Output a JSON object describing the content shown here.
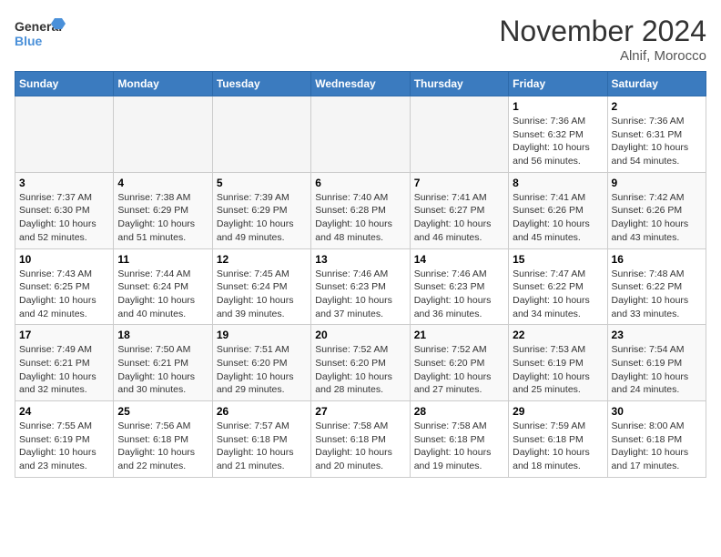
{
  "logo": {
    "line1": "General",
    "line2": "Blue"
  },
  "title": "November 2024",
  "location": "Alnif, Morocco",
  "days_header": [
    "Sunday",
    "Monday",
    "Tuesday",
    "Wednesday",
    "Thursday",
    "Friday",
    "Saturday"
  ],
  "weeks": [
    [
      {
        "num": "",
        "info": ""
      },
      {
        "num": "",
        "info": ""
      },
      {
        "num": "",
        "info": ""
      },
      {
        "num": "",
        "info": ""
      },
      {
        "num": "",
        "info": ""
      },
      {
        "num": "1",
        "info": "Sunrise: 7:36 AM\nSunset: 6:32 PM\nDaylight: 10 hours and 56 minutes."
      },
      {
        "num": "2",
        "info": "Sunrise: 7:36 AM\nSunset: 6:31 PM\nDaylight: 10 hours and 54 minutes."
      }
    ],
    [
      {
        "num": "3",
        "info": "Sunrise: 7:37 AM\nSunset: 6:30 PM\nDaylight: 10 hours and 52 minutes."
      },
      {
        "num": "4",
        "info": "Sunrise: 7:38 AM\nSunset: 6:29 PM\nDaylight: 10 hours and 51 minutes."
      },
      {
        "num": "5",
        "info": "Sunrise: 7:39 AM\nSunset: 6:29 PM\nDaylight: 10 hours and 49 minutes."
      },
      {
        "num": "6",
        "info": "Sunrise: 7:40 AM\nSunset: 6:28 PM\nDaylight: 10 hours and 48 minutes."
      },
      {
        "num": "7",
        "info": "Sunrise: 7:41 AM\nSunset: 6:27 PM\nDaylight: 10 hours and 46 minutes."
      },
      {
        "num": "8",
        "info": "Sunrise: 7:41 AM\nSunset: 6:26 PM\nDaylight: 10 hours and 45 minutes."
      },
      {
        "num": "9",
        "info": "Sunrise: 7:42 AM\nSunset: 6:26 PM\nDaylight: 10 hours and 43 minutes."
      }
    ],
    [
      {
        "num": "10",
        "info": "Sunrise: 7:43 AM\nSunset: 6:25 PM\nDaylight: 10 hours and 42 minutes."
      },
      {
        "num": "11",
        "info": "Sunrise: 7:44 AM\nSunset: 6:24 PM\nDaylight: 10 hours and 40 minutes."
      },
      {
        "num": "12",
        "info": "Sunrise: 7:45 AM\nSunset: 6:24 PM\nDaylight: 10 hours and 39 minutes."
      },
      {
        "num": "13",
        "info": "Sunrise: 7:46 AM\nSunset: 6:23 PM\nDaylight: 10 hours and 37 minutes."
      },
      {
        "num": "14",
        "info": "Sunrise: 7:46 AM\nSunset: 6:23 PM\nDaylight: 10 hours and 36 minutes."
      },
      {
        "num": "15",
        "info": "Sunrise: 7:47 AM\nSunset: 6:22 PM\nDaylight: 10 hours and 34 minutes."
      },
      {
        "num": "16",
        "info": "Sunrise: 7:48 AM\nSunset: 6:22 PM\nDaylight: 10 hours and 33 minutes."
      }
    ],
    [
      {
        "num": "17",
        "info": "Sunrise: 7:49 AM\nSunset: 6:21 PM\nDaylight: 10 hours and 32 minutes."
      },
      {
        "num": "18",
        "info": "Sunrise: 7:50 AM\nSunset: 6:21 PM\nDaylight: 10 hours and 30 minutes."
      },
      {
        "num": "19",
        "info": "Sunrise: 7:51 AM\nSunset: 6:20 PM\nDaylight: 10 hours and 29 minutes."
      },
      {
        "num": "20",
        "info": "Sunrise: 7:52 AM\nSunset: 6:20 PM\nDaylight: 10 hours and 28 minutes."
      },
      {
        "num": "21",
        "info": "Sunrise: 7:52 AM\nSunset: 6:20 PM\nDaylight: 10 hours and 27 minutes."
      },
      {
        "num": "22",
        "info": "Sunrise: 7:53 AM\nSunset: 6:19 PM\nDaylight: 10 hours and 25 minutes."
      },
      {
        "num": "23",
        "info": "Sunrise: 7:54 AM\nSunset: 6:19 PM\nDaylight: 10 hours and 24 minutes."
      }
    ],
    [
      {
        "num": "24",
        "info": "Sunrise: 7:55 AM\nSunset: 6:19 PM\nDaylight: 10 hours and 23 minutes."
      },
      {
        "num": "25",
        "info": "Sunrise: 7:56 AM\nSunset: 6:18 PM\nDaylight: 10 hours and 22 minutes."
      },
      {
        "num": "26",
        "info": "Sunrise: 7:57 AM\nSunset: 6:18 PM\nDaylight: 10 hours and 21 minutes."
      },
      {
        "num": "27",
        "info": "Sunrise: 7:58 AM\nSunset: 6:18 PM\nDaylight: 10 hours and 20 minutes."
      },
      {
        "num": "28",
        "info": "Sunrise: 7:58 AM\nSunset: 6:18 PM\nDaylight: 10 hours and 19 minutes."
      },
      {
        "num": "29",
        "info": "Sunrise: 7:59 AM\nSunset: 6:18 PM\nDaylight: 10 hours and 18 minutes."
      },
      {
        "num": "30",
        "info": "Sunrise: 8:00 AM\nSunset: 6:18 PM\nDaylight: 10 hours and 17 minutes."
      }
    ]
  ]
}
